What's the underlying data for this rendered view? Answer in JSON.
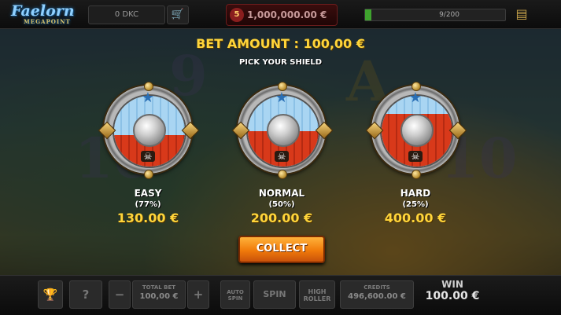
{
  "top_bar": {
    "logo": "Faelorn",
    "logo_sub": "MEGAPOINT",
    "currency_balance": "0 DKC",
    "jackpot_badge": "5",
    "jackpot": "1,000,000.00 €",
    "progress_text": "9/200",
    "progress_fraction": 0.045
  },
  "bonus": {
    "bet_amount": "BET AMOUNT : 100,00 €",
    "pick_prompt": "PICK YOUR SHIELD",
    "options": [
      {
        "level": "EASY",
        "chance": "(77%)",
        "prize": "130.00 €",
        "red_fraction": 0.45
      },
      {
        "level": "NORMAL",
        "chance": "(50%)",
        "prize": "200.00 €",
        "red_fraction": 0.5
      },
      {
        "level": "HARD",
        "chance": "(25%)",
        "prize": "400.00 €",
        "red_fraction": 0.75
      }
    ],
    "collect_label": "COLLECT"
  },
  "bottom_bar": {
    "total_bet_caption": "TOTAL BET",
    "total_bet_value": "100,00 €",
    "auto_spin": "AUTO SPIN",
    "spin": "SPIN",
    "high_roller": "HIGH ROLLER",
    "credits_caption": "CREDITS",
    "credits_value": "496,600.00 €",
    "win_caption": "WIN",
    "win_value": "100.00 €",
    "info_symbol": "?",
    "minus_symbol": "−",
    "plus_symbol": "+"
  },
  "colors": {
    "accent_gold": "#ffd53a",
    "collect_orange": "#f07a0a",
    "shield_blue": "#a9d5f2",
    "shield_red": "#d8391a",
    "progress_green": "#3fa32e"
  }
}
